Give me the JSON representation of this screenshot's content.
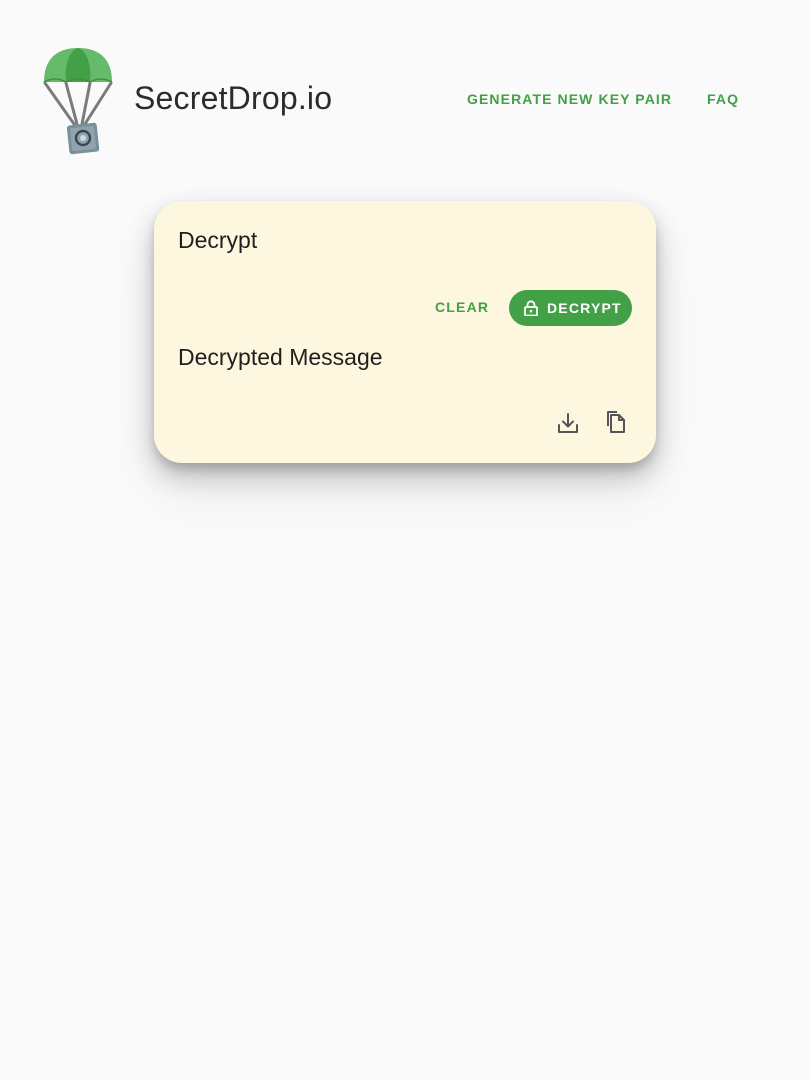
{
  "header": {
    "brand": "SecretDrop.io",
    "nav": {
      "generate_label": "GENERATE NEW KEY PAIR",
      "faq_label": "FAQ"
    }
  },
  "card": {
    "title": "Decrypt",
    "clear_label": "CLEAR",
    "decrypt_label": "DECRYPT",
    "decrypt_icon": "lock-icon",
    "message_title": "Decrypted Message",
    "actions": {
      "download_icon": "download-icon",
      "copy_icon": "copy-icon"
    }
  },
  "colors": {
    "accent": "#43a047",
    "card_background": "#fef7df",
    "page_background": "#fafafa",
    "text": "#1f1f1f"
  }
}
